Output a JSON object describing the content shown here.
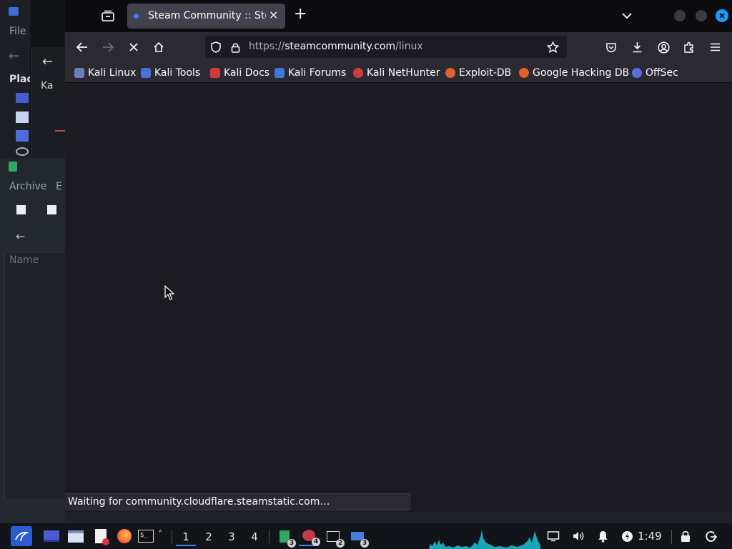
{
  "background_windows": {
    "file_manager": {
      "menu_file": "File",
      "places_label": "Plac"
    },
    "kali_window": {
      "tab_label": "Ka"
    },
    "archive_manager": {
      "menu_archive": "Archive",
      "menu_edit": "E",
      "column_name": "Name"
    }
  },
  "browser": {
    "tab": {
      "title": "Steam Community :: Steam",
      "close": "×"
    },
    "new_tab": "+",
    "url": {
      "scheme": "https://",
      "host": "steamcommunity.com",
      "path": "/linux"
    },
    "bookmarks": [
      {
        "label": "Kali Linux",
        "icon": "kali-dragon-icon",
        "color": "#6b7dba"
      },
      {
        "label": "Kali Tools",
        "icon": "kali-tools-icon",
        "color": "#4a6fd8"
      },
      {
        "label": "Kali Docs",
        "icon": "kali-docs-icon",
        "color": "#d03a3a"
      },
      {
        "label": "Kali Forums",
        "icon": "kali-forums-icon",
        "color": "#3b7ad8"
      },
      {
        "label": "Kali NetHunter",
        "icon": "nethunter-icon",
        "color": "#d03a3a"
      },
      {
        "label": "Exploit-DB",
        "icon": "exploit-db-icon",
        "color": "#e0642a"
      },
      {
        "label": "Google Hacking DB",
        "icon": "ghdb-icon",
        "color": "#e0642a"
      },
      {
        "label": "OffSec",
        "icon": "offsec-icon",
        "color": "#5a6de0"
      }
    ],
    "status": "Waiting for community.cloudflare.steamstatic.com…",
    "colors": {
      "accent": "#3a86ff",
      "close_button": "#1e9af5"
    }
  },
  "taskbar": {
    "workspaces": [
      "1",
      "2",
      "3",
      "4"
    ],
    "active_workspace": "1",
    "badges": {
      "text_editor": "3",
      "firefox": "4",
      "terminal": "2",
      "files": "3"
    },
    "clock": "1:49"
  }
}
